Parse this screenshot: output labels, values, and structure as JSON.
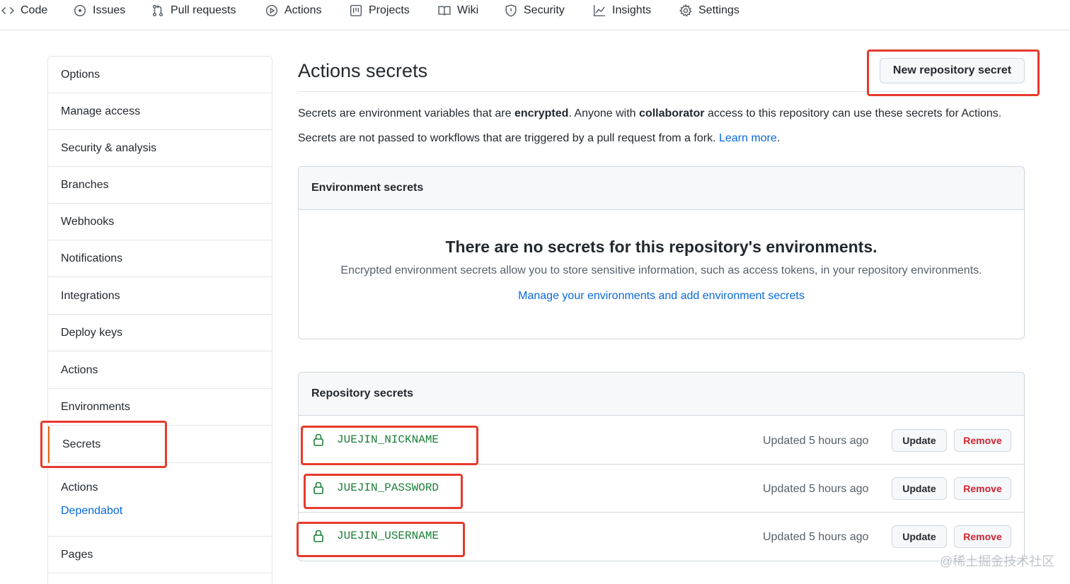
{
  "nav": {
    "tabs": [
      {
        "label": "Code",
        "icon": "code-icon"
      },
      {
        "label": "Issues",
        "icon": "issue-icon"
      },
      {
        "label": "Pull requests",
        "icon": "pull-request-icon"
      },
      {
        "label": "Actions",
        "icon": "play-icon"
      },
      {
        "label": "Projects",
        "icon": "project-icon"
      },
      {
        "label": "Wiki",
        "icon": "book-icon"
      },
      {
        "label": "Security",
        "icon": "shield-icon"
      },
      {
        "label": "Insights",
        "icon": "graph-icon"
      },
      {
        "label": "Settings",
        "icon": "gear-icon"
      }
    ]
  },
  "sidebar": {
    "items": [
      {
        "label": "Options"
      },
      {
        "label": "Manage access"
      },
      {
        "label": "Security & analysis"
      },
      {
        "label": "Branches"
      },
      {
        "label": "Webhooks"
      },
      {
        "label": "Notifications"
      },
      {
        "label": "Integrations"
      },
      {
        "label": "Deploy keys"
      },
      {
        "label": "Actions"
      },
      {
        "label": "Environments"
      },
      {
        "label": "Secrets",
        "selected": true
      }
    ],
    "group": {
      "title": "Actions",
      "link": "Dependabot"
    },
    "after": [
      {
        "label": "Pages"
      }
    ]
  },
  "main": {
    "title": "Actions secrets",
    "new_button": "New repository secret",
    "desc1": {
      "p1": "Secrets are environment variables that are ",
      "b1": "encrypted",
      "p2": ". Anyone with ",
      "b2": "collaborator",
      "p3": " access to this repository can use these secrets for Actions."
    },
    "desc2": {
      "text": "Secrets are not passed to workflows that are triggered by a pull request from a fork. ",
      "link": "Learn more",
      "end": "."
    },
    "environment": {
      "header": "Environment secrets",
      "blank_title": "There are no secrets for this repository's environments.",
      "blank_text": "Encrypted environment secrets allow you to store sensitive information, such as access tokens, in your repository environments.",
      "blank_link": "Manage your environments and add environment secrets"
    },
    "repository": {
      "header": "Repository secrets",
      "secrets": [
        {
          "name": "JUEJIN_NICKNAME",
          "updated": "Updated 5 hours ago",
          "update": "Update",
          "remove": "Remove"
        },
        {
          "name": "JUEJIN_PASSWORD",
          "updated": "Updated 5 hours ago",
          "update": "Update",
          "remove": "Remove"
        },
        {
          "name": "JUEJIN_USERNAME",
          "updated": "Updated 5 hours ago",
          "update": "Update",
          "remove": "Remove"
        }
      ]
    }
  },
  "watermark": "@稀土掘金技术社区",
  "colors": {
    "link": "#0969da",
    "secret_name": "#1a7f37",
    "remove": "#cf222e",
    "highlight": "#e53b2c",
    "selected_bar": "#e36209"
  }
}
